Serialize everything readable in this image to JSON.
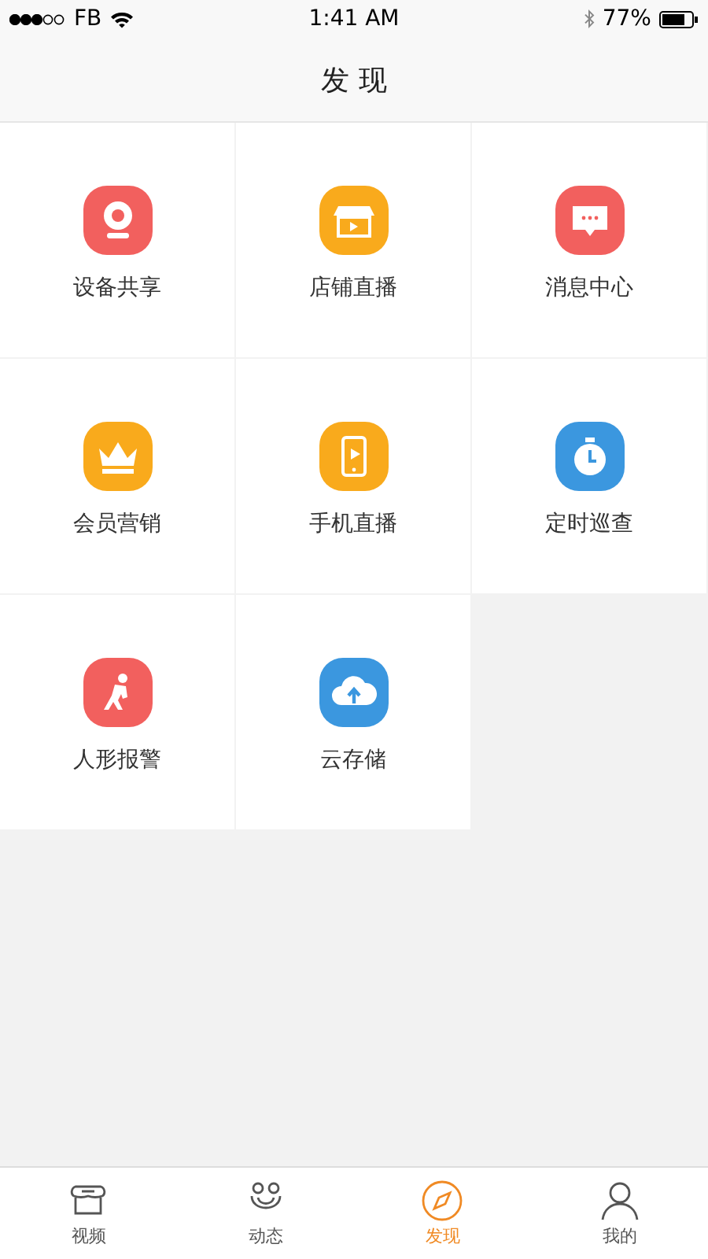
{
  "status_bar": {
    "carrier": "FB",
    "time": "1:41 AM",
    "battery": "77%"
  },
  "nav_bar": {
    "title": "发 现"
  },
  "features": [
    {
      "label": "设备共享",
      "color": "#f2605e"
    },
    {
      "label": "店铺直播",
      "color": "#f9aa1c"
    },
    {
      "label": "消息中心",
      "color": "#f2605e"
    },
    {
      "label": "会员营销",
      "color": "#f9aa1c"
    },
    {
      "label": "手机直播",
      "color": "#f9aa1c"
    },
    {
      "label": "定时巡查",
      "color": "#3b97df"
    },
    {
      "label": "人形报警",
      "color": "#f2605e"
    },
    {
      "label": "云存储",
      "color": "#3b97df"
    }
  ],
  "tab_bar": [
    {
      "label": "视频",
      "selected": false
    },
    {
      "label": "动态",
      "selected": false
    },
    {
      "label": "发现",
      "selected": true
    },
    {
      "label": "我的",
      "selected": false
    }
  ]
}
